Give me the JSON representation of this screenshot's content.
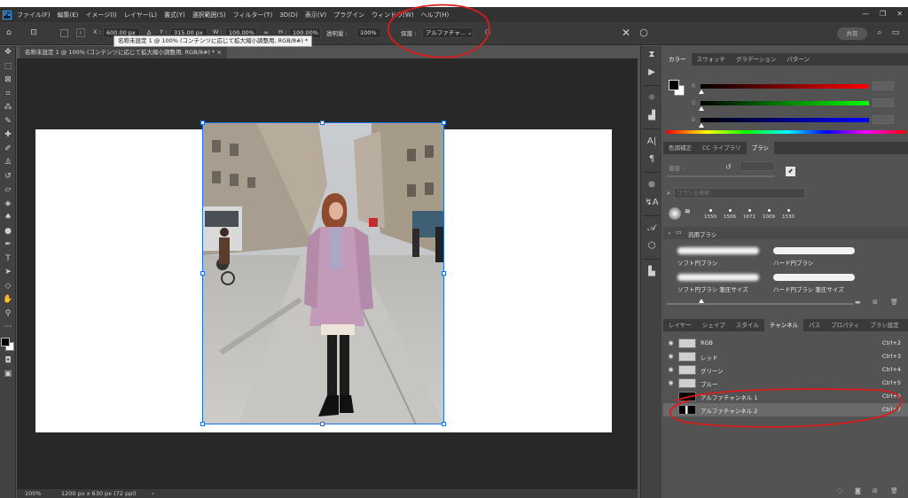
{
  "menu": [
    "ファイル(F)",
    "編集(E)",
    "イメージ(I)",
    "レイヤー(L)",
    "書式(Y)",
    "選択範囲(S)",
    "フィルター(T)",
    "3D(D)",
    "表示(V)",
    "プラグイン",
    "ウィンドウ(W)",
    "ヘルプ(H)"
  ],
  "window_controls": [
    "—",
    "❐",
    "✕"
  ],
  "options": {
    "x_label": "X :",
    "x_value": "600.00 px",
    "y_label": "Y :",
    "y_value": "315.00 px",
    "w_label": "W :",
    "w_value": "100.00%",
    "h_label": "H :",
    "h_value": "100.00%",
    "opacity_label": "透明量 :",
    "opacity_value": "100%",
    "protect_label": "保護 :",
    "protect_value": "アルファチャ... ⌄",
    "share_label": "共有"
  },
  "tooltip": "名称未設定 1 @ 100% (コンテンツに応じて拡大縮小調整用, RGB/8#) *",
  "document_tab": "名称未設定 1 @ 100% (コンテンツに応じて拡大縮小調整用, RGB/8#) *  ×",
  "status": {
    "zoom": "100%",
    "size": "1200 px x 630 px (72 ppi)",
    "arrow": "›"
  },
  "color_panel": {
    "tabs": [
      "カラー",
      "スウォッチ",
      "グラデーション",
      "パターン"
    ],
    "labels": [
      "R",
      "G",
      "B"
    ]
  },
  "brush_panel": {
    "tabs": [
      "色調補正",
      "CC ライブラリ",
      "ブラシ"
    ],
    "size_label": "直径 :",
    "search_placeholder": "ブラシを検索",
    "sizes": [
      "1550",
      "1506",
      "1671",
      "1009",
      "1530"
    ],
    "group": "汎用ブラシ",
    "brushes": [
      "ソフト円ブラシ",
      "ハード円ブラシ",
      "ソフト円ブラシ 筆圧サイズ",
      "ハード円ブラシ 筆圧サイズ"
    ]
  },
  "channels_panel": {
    "tabs": [
      "レイヤー",
      "シェイプ",
      "スタイル",
      "チャンネル",
      "パス",
      "プロパティ",
      "ブラシ設定"
    ],
    "channels": [
      {
        "name": "RGB",
        "key": "Ctrl+2"
      },
      {
        "name": "レッド",
        "key": "Ctrl+3"
      },
      {
        "name": "グリーン",
        "key": "Ctrl+4"
      },
      {
        "name": "ブルー",
        "key": "Ctrl+5"
      },
      {
        "name": "アルファチャンネル 1",
        "key": "Ctrl+6"
      },
      {
        "name": "アルファチャンネル 2",
        "key": "Ctrl+7"
      }
    ]
  },
  "colors": {
    "accent": "#1473e6",
    "annotation": "#d91c1c"
  }
}
